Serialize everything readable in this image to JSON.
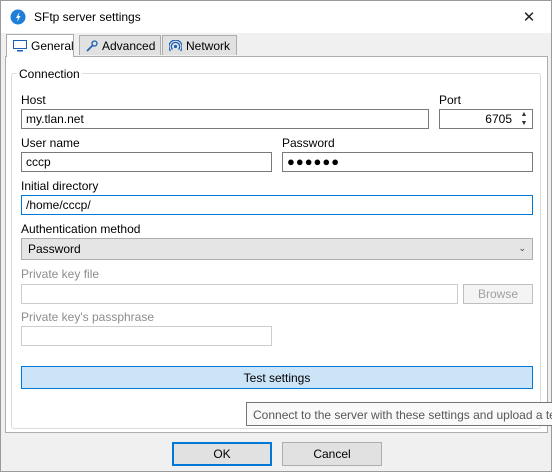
{
  "window": {
    "title": "SFtp server settings"
  },
  "tabs": [
    {
      "label": "General",
      "icon": "monitor-icon"
    },
    {
      "label": "Advanced",
      "icon": "wrench-icon"
    },
    {
      "label": "Network",
      "icon": "signal-icon"
    }
  ],
  "connection": {
    "group_label": "Connection",
    "host_label": "Host",
    "host_value": "my.tlan.net",
    "port_label": "Port",
    "port_value": "6705",
    "username_label": "User name",
    "username_value": "cccp",
    "password_label": "Password",
    "password_mask": "●●●●●●",
    "initial_dir_label": "Initial directory",
    "initial_dir_value": "/home/cccp/",
    "auth_label": "Authentication method",
    "auth_value": "Password",
    "private_key_label": "Private key file",
    "private_key_value": "",
    "browse_label": "Browse",
    "passphrase_label": "Private key's passphrase",
    "passphrase_value": "",
    "test_label": "Test settings"
  },
  "tooltip": "Connect to the server with these settings and upload a te",
  "footer": {
    "ok_label": "OK",
    "cancel_label": "Cancel"
  },
  "colors": {
    "accent": "#0078d7",
    "test_button_bg": "#cce4f7"
  }
}
